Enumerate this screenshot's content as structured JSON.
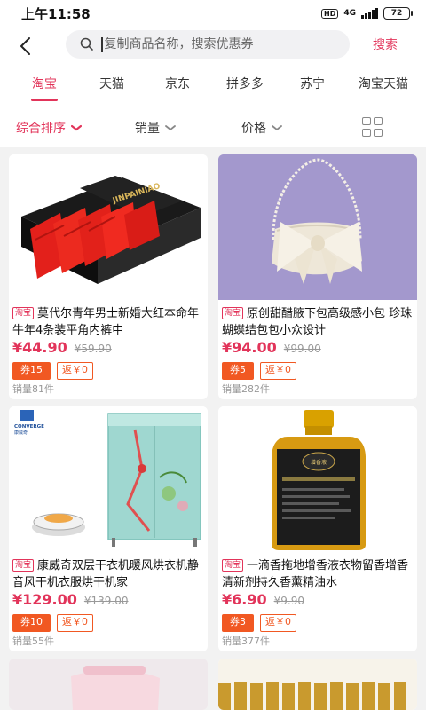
{
  "status": {
    "time": "上午11:58",
    "hd": "HD",
    "network": "4G",
    "battery": "72"
  },
  "header": {
    "search_placeholder": "复制商品名称，搜索优惠券",
    "search_button": "搜索"
  },
  "tabs": [
    {
      "label": "淘宝",
      "active": true
    },
    {
      "label": "天猫"
    },
    {
      "label": "京东"
    },
    {
      "label": "拼多多"
    },
    {
      "label": "苏宁"
    },
    {
      "label": "淘宝天猫"
    }
  ],
  "sort": {
    "comprehensive": "综合排序",
    "sales": "销量",
    "price": "价格"
  },
  "products": [
    {
      "source": "淘宝",
      "title": "莫代尔青年男士新婚大红本命年牛年4条装平角内裤中",
      "price": "¥44.90",
      "original": "¥59.90",
      "coupon": "券15",
      "rebate": "返￥0",
      "sales": "销量81件",
      "brand_text": "JINPAINIAO"
    },
    {
      "source": "淘宝",
      "title": "原创甜醋腋下包高级感小包 珍珠蝴蝶结包包小众设计",
      "price": "¥94.00",
      "original": "¥99.00",
      "coupon": "券5",
      "rebate": "返￥0",
      "sales": "销量282件"
    },
    {
      "source": "淘宝",
      "title": "康威奇双层干衣机暖风烘衣机静音风干机衣服烘干机家",
      "price": "¥129.00",
      "original": "¥139.00",
      "coupon": "券10",
      "rebate": "返￥0",
      "sales": "销量55件",
      "brand_text": "CONVERGE",
      "brand_sub": "康威奇"
    },
    {
      "source": "淘宝",
      "title": "一滴香拖地增香液衣物留香增香清新剂持久香薰精油水",
      "price": "¥6.90",
      "original": "¥9.90",
      "coupon": "券3",
      "rebate": "返￥0",
      "sales": "销量377件",
      "label_text": "增香液"
    }
  ]
}
